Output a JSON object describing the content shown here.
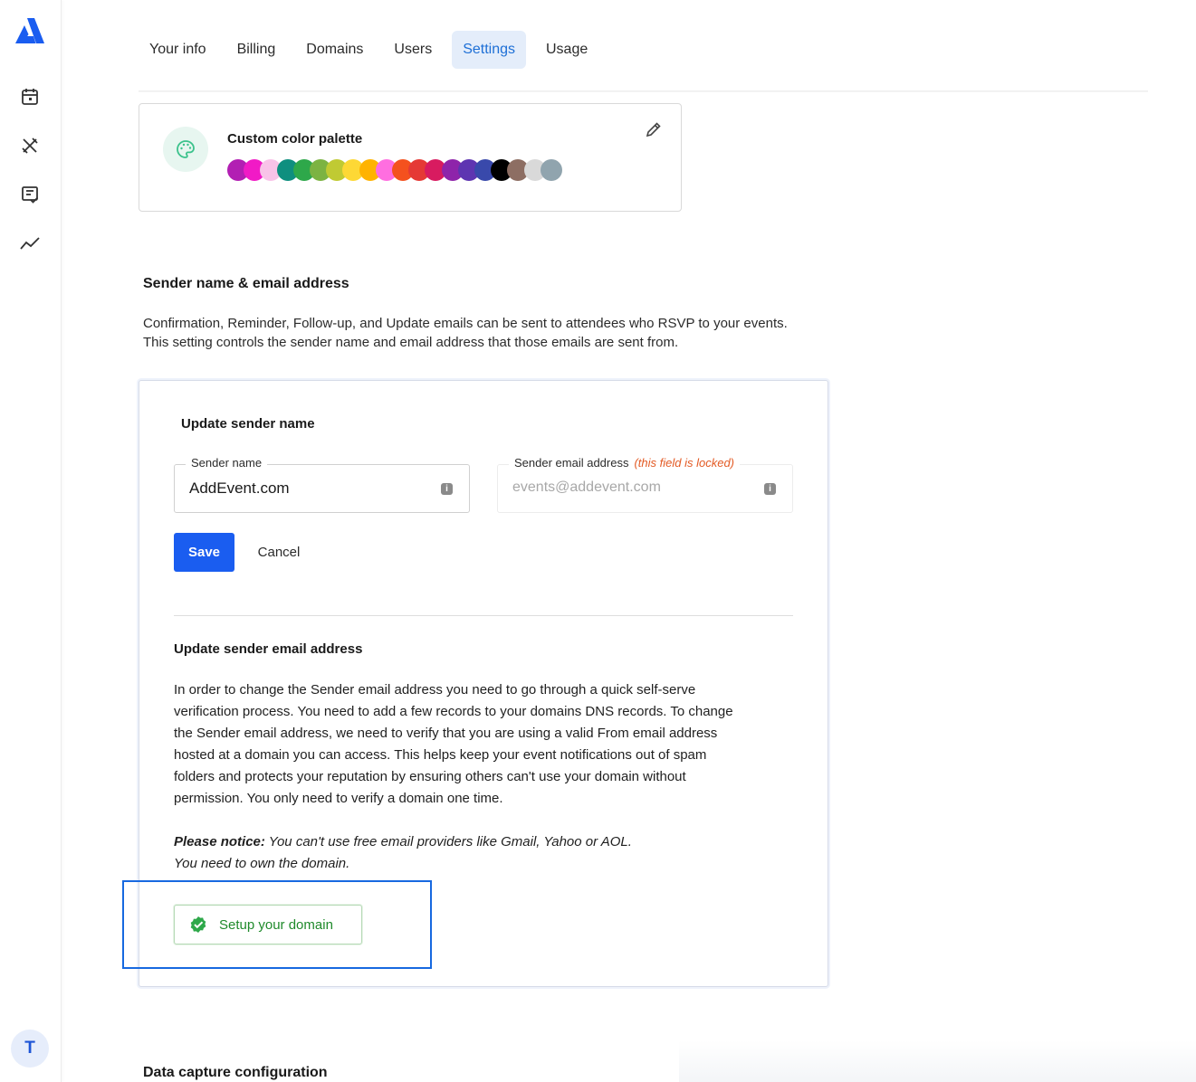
{
  "tabs": [
    {
      "label": "Your info",
      "active": false
    },
    {
      "label": "Billing",
      "active": false
    },
    {
      "label": "Domains",
      "active": false
    },
    {
      "label": "Users",
      "active": false
    },
    {
      "label": "Settings",
      "active": true
    },
    {
      "label": "Usage",
      "active": false
    }
  ],
  "rail": {
    "icons": [
      "calendar-icon",
      "tools-icon",
      "checklist-icon",
      "analytics-icon"
    ],
    "avatar_initial": "T"
  },
  "palette": {
    "title": "Custom color palette",
    "colors": [
      "#b21fb3",
      "#f11ac6",
      "#f9c3e8",
      "#0f8f7f",
      "#2ea84a",
      "#7cb342",
      "#c0ca33",
      "#fdd835",
      "#ffb300",
      "#ff6ee0",
      "#f4511e",
      "#e53935",
      "#d81b60",
      "#8e24aa",
      "#5e35b1",
      "#3949ab",
      "#000000",
      "#8d6e63",
      "#d9d9d9",
      "#90a4ae"
    ]
  },
  "sender": {
    "title": "Sender name & email address",
    "desc_lines": [
      "Confirmation, Reminder, Follow-up, and Update emails can be sent to attendees who RSVP to your events.",
      "This setting controls the sender name and email address that those emails are sent from."
    ],
    "update_name_title": "Update sender name",
    "name_label": "Sender name",
    "name_value": "AddEvent.com",
    "email_label": "Sender email address",
    "email_locked_note": "(this field is locked)",
    "email_value": "events@addevent.com",
    "save_label": "Save",
    "cancel_label": "Cancel",
    "update_email_title": "Update sender email address",
    "body_lines": [
      "In order to change the Sender email address you need to go through a quick self-serve",
      "verification process. You need to add a few records to your domains DNS records. To change",
      "the Sender email address, we need to verify that you are using a valid From email address",
      "hosted at a domain you can access. This helps keep your event notifications out of spam",
      "folders and protects your reputation by ensuring others can't use your domain without",
      "permission. You only need to verify a domain one time."
    ],
    "notice_bold": "Please notice:",
    "notice_line1": " You can't use free email providers like Gmail, Yahoo or AOL.",
    "notice_line2": "You need to own the domain.",
    "setup_domain_label": "Setup your domain"
  },
  "data_capture": {
    "title": "Data capture configuration"
  }
}
